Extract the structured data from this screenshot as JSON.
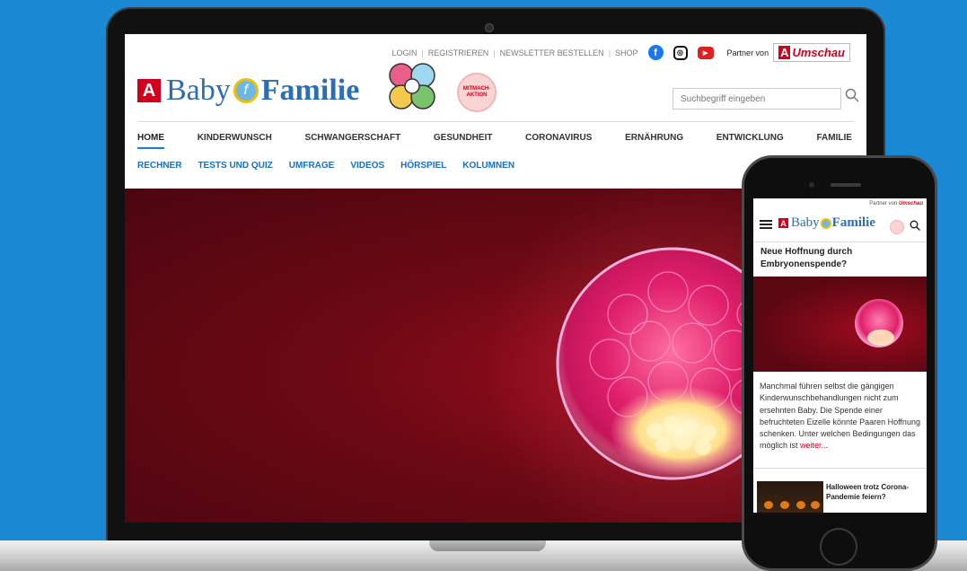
{
  "desktop": {
    "topbar": {
      "login": "LOGIN",
      "register": "REGISTRIEREN",
      "newsletter": "NEWSLETTER BESTELLEN",
      "shop": "SHOP",
      "partner_label": "Partner von",
      "partner_name": "Umschau"
    },
    "logo": {
      "part1": "Baby",
      "part2": "Familie"
    },
    "mitmach_badge": "MITMACH-\nAKTION",
    "search": {
      "placeholder": "Suchbegriff eingeben"
    },
    "nav_primary": [
      "HOME",
      "KINDERWUNSCH",
      "SCHWANGERSCHAFT",
      "GESUNDHEIT",
      "CORONAVIRUS",
      "ERNÄHRUNG",
      "ENTWICKLUNG",
      "FAMILIE"
    ],
    "nav_secondary": [
      "RECHNER",
      "TESTS UND QUIZ",
      "UMFRAGE",
      "VIDEOS",
      "HÖRSPIEL",
      "KOLUMNEN"
    ]
  },
  "mobile": {
    "partner_label": "Partner von",
    "partner_name": "Umschau",
    "logo": {
      "part1": "Baby",
      "part2": "Familie"
    },
    "headline": "Neue Hoffnung durch Embryonenspende?",
    "teaser": "Manchmal führen selbst die gängigen Kinderwunschbehandlungen nicht zum ersehnten Baby. Die Spende einer befruchteten Eizelle könnte Paaren Hoffnung schenken. Unter welchen Bedingungen das möglich ist",
    "more_link": "weiter...",
    "headline2": "Halloween trotz Corona-Pandemie feiern?"
  },
  "colors": {
    "brand_blue": "#2a6fb5",
    "brand_red": "#d2001e",
    "background": "#1a88d2"
  }
}
